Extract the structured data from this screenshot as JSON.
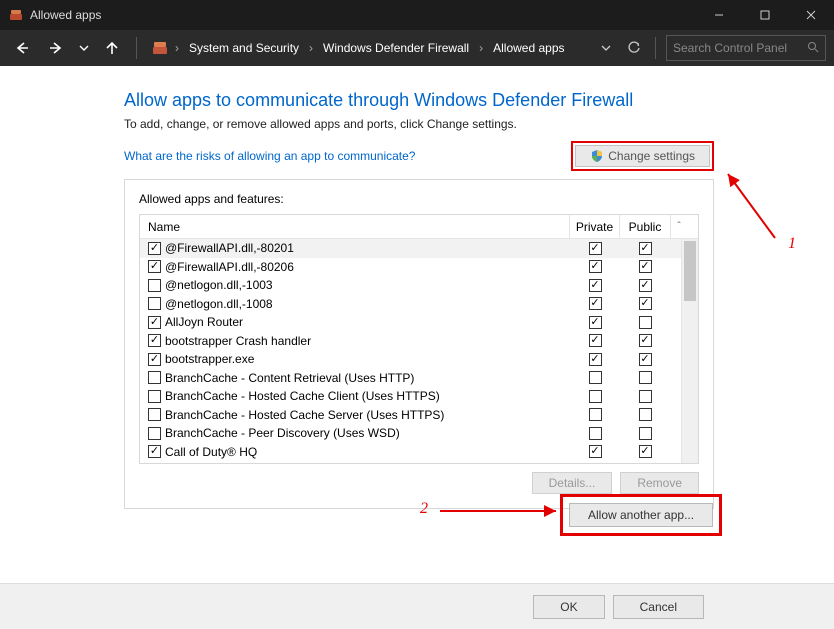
{
  "window": {
    "title": "Allowed apps"
  },
  "breadcrumb": {
    "items": [
      "System and Security",
      "Windows Defender Firewall",
      "Allowed apps"
    ]
  },
  "search": {
    "placeholder": "Search Control Panel"
  },
  "page": {
    "heading": "Allow apps to communicate through Windows Defender Firewall",
    "subdesc": "To add, change, or remove allowed apps and ports, click Change settings.",
    "help_link": "What are the risks of allowing an app to communicate?",
    "change_settings": "Change settings"
  },
  "group": {
    "title": "Allowed apps and features:",
    "cols": {
      "name": "Name",
      "private": "Private",
      "public": "Public"
    }
  },
  "apps": [
    {
      "name": "@FirewallAPI.dll,-80201",
      "enabled": true,
      "private": true,
      "public": true
    },
    {
      "name": "@FirewallAPI.dll,-80206",
      "enabled": true,
      "private": true,
      "public": true
    },
    {
      "name": "@netlogon.dll,-1003",
      "enabled": false,
      "private": true,
      "public": true
    },
    {
      "name": "@netlogon.dll,-1008",
      "enabled": false,
      "private": true,
      "public": true
    },
    {
      "name": "AllJoyn Router",
      "enabled": true,
      "private": true,
      "public": false
    },
    {
      "name": "bootstrapper Crash handler",
      "enabled": true,
      "private": true,
      "public": true
    },
    {
      "name": "bootstrapper.exe",
      "enabled": true,
      "private": true,
      "public": true
    },
    {
      "name": "BranchCache - Content Retrieval (Uses HTTP)",
      "enabled": false,
      "private": false,
      "public": false
    },
    {
      "name": "BranchCache - Hosted Cache Client (Uses HTTPS)",
      "enabled": false,
      "private": false,
      "public": false
    },
    {
      "name": "BranchCache - Hosted Cache Server (Uses HTTPS)",
      "enabled": false,
      "private": false,
      "public": false
    },
    {
      "name": "BranchCache - Peer Discovery (Uses WSD)",
      "enabled": false,
      "private": false,
      "public": false
    },
    {
      "name": "Call of Duty® HQ",
      "enabled": true,
      "private": true,
      "public": true
    }
  ],
  "buttons": {
    "details": "Details...",
    "remove": "Remove",
    "allow_another": "Allow another app...",
    "ok": "OK",
    "cancel": "Cancel"
  },
  "annotations": {
    "one": "1",
    "two": "2"
  }
}
